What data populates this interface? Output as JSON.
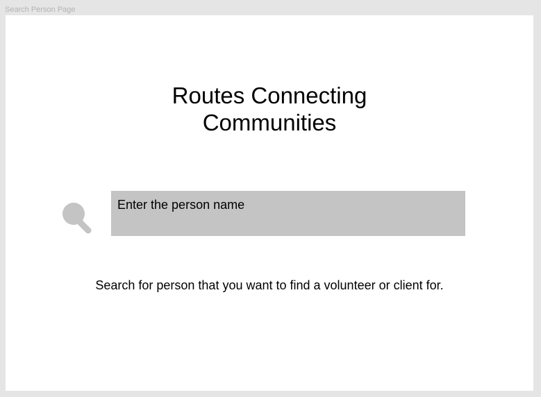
{
  "frame": {
    "label": "Search Person Page"
  },
  "header": {
    "title_line1": "Routes Connecting",
    "title_line2": "Communities"
  },
  "search": {
    "icon": "search-icon",
    "placeholder": "Enter the person name"
  },
  "main": {
    "helper_text": "Search for person that you want to find a volunteer or client for."
  },
  "colors": {
    "canvas_background": "#e5e5e5",
    "frame_background": "#ffffff",
    "input_background": "#c4c4c4",
    "icon_color": "#c4c4c4",
    "text_color": "#000000",
    "frame_label_color": "#b3b3b3"
  }
}
